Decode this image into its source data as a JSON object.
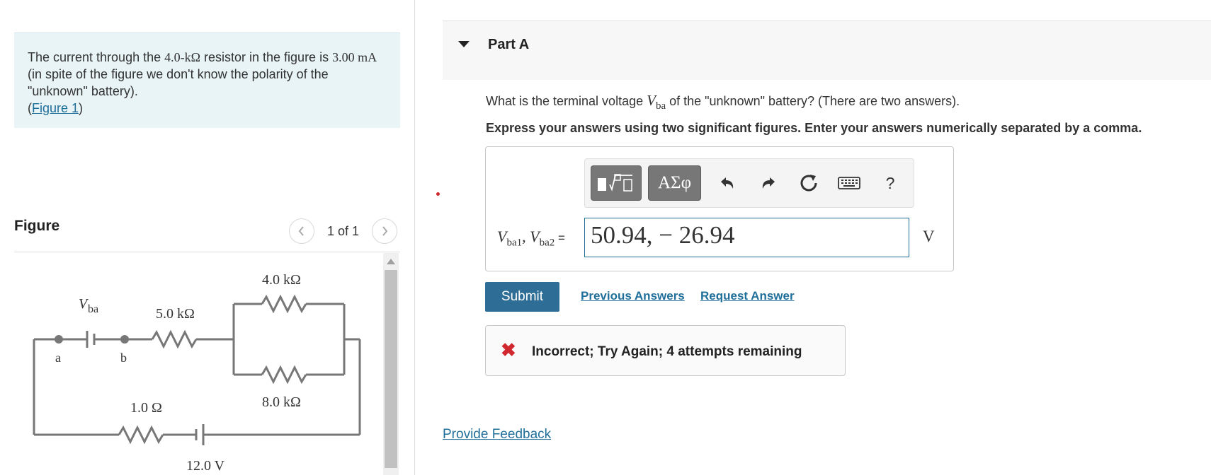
{
  "problem": {
    "text_1": "The current through the ",
    "resistor_value": "4.0-kΩ",
    "text_2": " resistor in the figure is ",
    "current_value": "3.00 mA",
    "text_3": " (in spite of the figure we don't know the polarity of the \"unknown\" battery).",
    "figure_link_open": "(",
    "figure_link": "Figure 1",
    "figure_link_close": ")"
  },
  "figure": {
    "title": "Figure",
    "pager_text": "1 of 1",
    "prev_icon": "chevron-left-icon",
    "next_icon": "chevron-right-icon",
    "circuit_labels": {
      "vba": "V",
      "vba_sub": "ba",
      "node_a": "a",
      "node_b": "b",
      "r_top": "4.0 kΩ",
      "r_mid": "5.0 kΩ",
      "r_bottom_right": "8.0 kΩ",
      "r_internal": "1.0 Ω",
      "battery": "12.0 V"
    }
  },
  "part": {
    "title": "Part A",
    "question_pre": "What is the terminal voltage ",
    "question_var": "V",
    "question_sub": "ba",
    "question_post": " of the \"unknown\" battery? (There are two answers).",
    "instruction": "Express your answers using two significant figures. Enter your answers numerically separated by a comma."
  },
  "toolbar": {
    "template_icon": "templates-icon",
    "symbols_label": "ΑΣφ",
    "undo_icon": "undo-icon",
    "redo_icon": "redo-icon",
    "reset_icon": "reset-icon",
    "keyboard_icon": "keyboard-icon",
    "help_label": "?"
  },
  "answer": {
    "var1": "V",
    "var1_sub": "ba1",
    "sep": ", ",
    "var2": "V",
    "var2_sub": "ba2",
    "equals": " =",
    "value": "50.94, − 26.94",
    "unit": "V"
  },
  "actions": {
    "submit": "Submit",
    "previous_answers": "Previous Answers",
    "request_answer": "Request Answer"
  },
  "feedback": {
    "icon": "x-icon",
    "text": "Incorrect; Try Again; 4 attempts remaining"
  },
  "footer": {
    "provide_feedback": "Provide Feedback"
  },
  "colors": {
    "link": "#1f6f9a",
    "submit_bg": "#2e6e96",
    "problem_bg": "#e8f4f6",
    "error_red": "#d0282e"
  }
}
